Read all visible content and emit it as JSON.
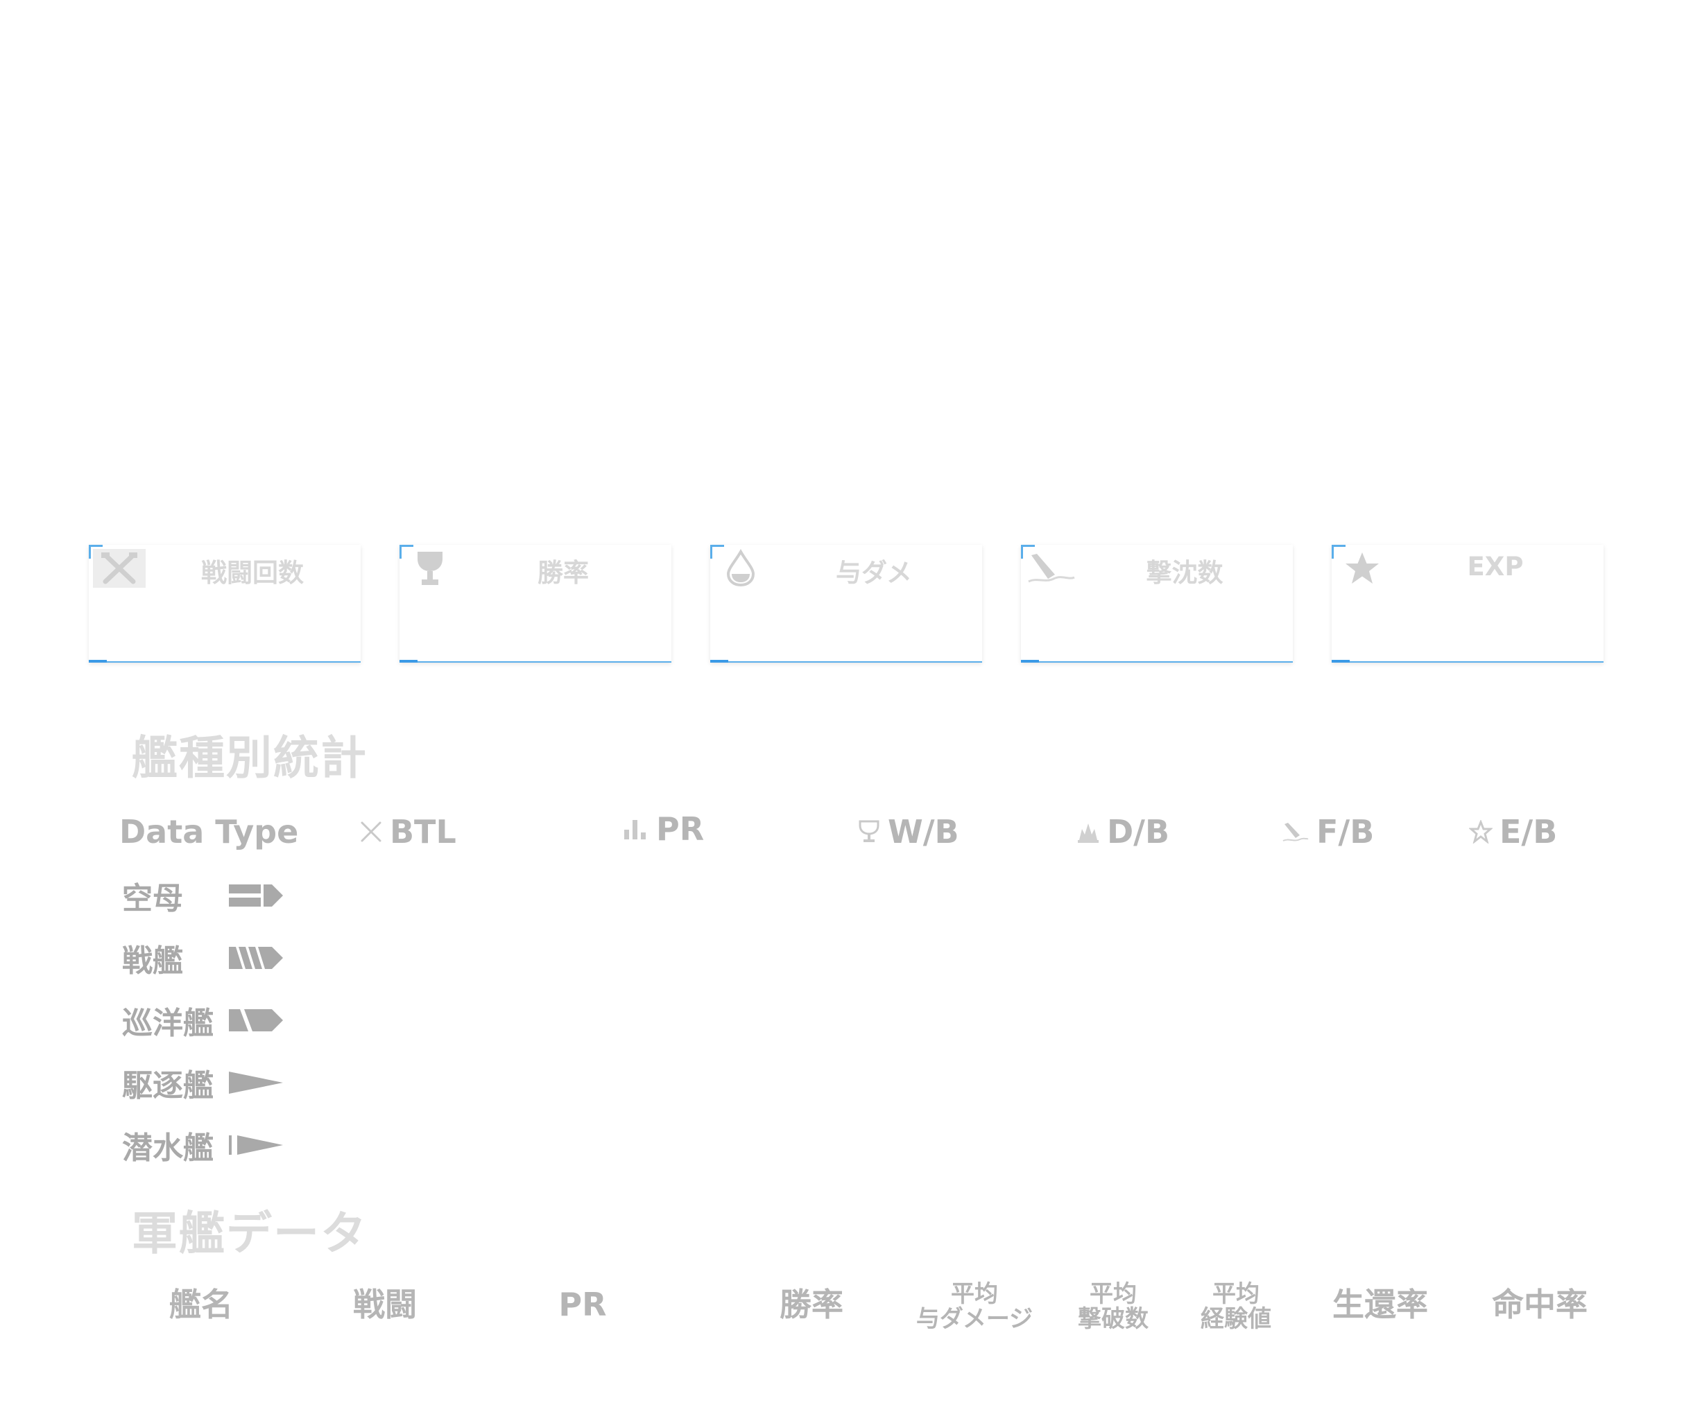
{
  "overview_cards": [
    {
      "title": "戦闘回数",
      "icon": "crossed-swords-icon"
    },
    {
      "title": "勝率",
      "icon": "trophy-icon"
    },
    {
      "title": "与ダメ",
      "icon": "droplet-icon"
    },
    {
      "title": "撃沈数",
      "icon": "sinking-ship-icon"
    },
    {
      "title": "EXP",
      "icon": "star-icon"
    }
  ],
  "ship_type_section": {
    "title": "艦種別統計",
    "header": {
      "data_type": "Data Type",
      "btl": "BTL",
      "pr": "PR",
      "wb": "W/B",
      "db": "D/B",
      "fb": "F/B",
      "eb": "E/B"
    },
    "rows": [
      {
        "label": "空母",
        "icon": "aircraft-carrier-icon"
      },
      {
        "label": "戦艦",
        "icon": "battleship-icon"
      },
      {
        "label": "巡洋艦",
        "icon": "cruiser-icon"
      },
      {
        "label": "駆逐艦",
        "icon": "destroyer-icon"
      },
      {
        "label": "潜水艦",
        "icon": "submarine-icon"
      }
    ]
  },
  "warship_section": {
    "title": "軍艦データ",
    "columns": {
      "name": "艦名",
      "battles": "戦闘",
      "pr": "PR",
      "win_rate": "勝率",
      "avg_damage_1": "平均",
      "avg_damage_2": "与ダメージ",
      "avg_frags_1": "平均",
      "avg_frags_2": "撃破数",
      "avg_exp_1": "平均",
      "avg_exp_2": "経験値",
      "survival": "生還率",
      "hit_rate": "命中率"
    }
  },
  "colors": {
    "accent": "#5aaeea",
    "muted_text": "#b5b5b5",
    "faint_text": "#d7d7d7"
  }
}
